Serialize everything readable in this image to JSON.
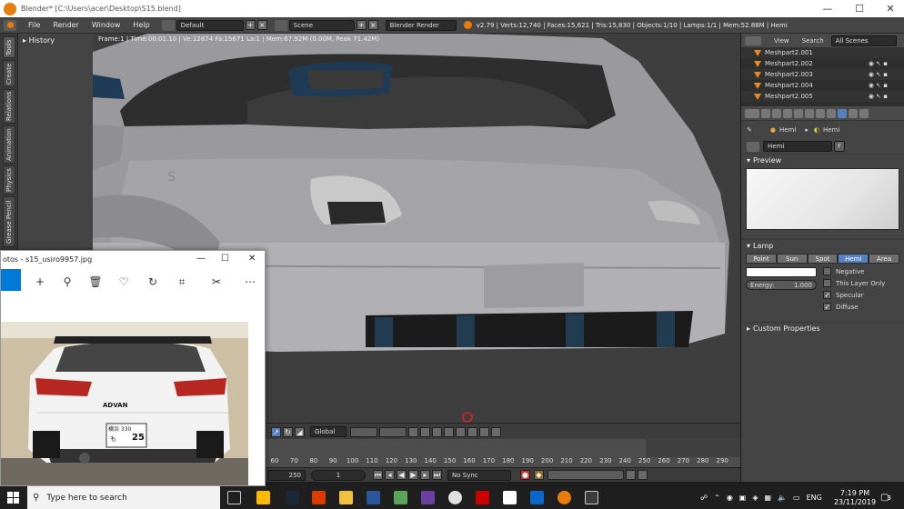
{
  "window": {
    "title": "Blender* [C:\\Users\\acer\\Desktop\\S15.blend]",
    "minimize": "—",
    "maximize": "☐",
    "close": "✕"
  },
  "menubar": {
    "items": [
      "File",
      "Render",
      "Window",
      "Help"
    ],
    "layout": "Default",
    "scene": "Scene",
    "engine": "Blender Render",
    "stats": "v2.79 | Verts:12,740 | Faces:15,621 | Tris:15,830 | Objects:1/10 | Lamps:1/1 | Mem:52.88M | Hemi"
  },
  "tooltabs": [
    "Tools",
    "Create",
    "Relations",
    "Animation",
    "Physics",
    "Grease Pencil"
  ],
  "history": {
    "label": "History"
  },
  "viewport": {
    "info": "Frame:1 | Time:00:01.10 | Ve:12874 Fa:15671 La:1 | Mem:67.92M (0.00M, Peak 71.42M)"
  },
  "outliner": {
    "view": "View",
    "search": "Search",
    "filter": "All Scenes",
    "items": [
      "Meshpart2.001",
      "Meshpart2.002",
      "Meshpart2.003",
      "Meshpart2.004",
      "Meshpart2.005"
    ]
  },
  "properties": {
    "breadcrumb_obj": "Hemi",
    "breadcrumb_data": "Hemi",
    "datablock": "Hemi",
    "datablock_user": "F",
    "preview_label": "Preview",
    "lamp_label": "Lamp",
    "lamp_types": [
      "Point",
      "Sun",
      "Spot",
      "Hemi",
      "Area"
    ],
    "lamp_active": "Hemi",
    "energy_label": "Energy:",
    "energy_value": "1.000",
    "options": [
      {
        "label": "Negative",
        "checked": false
      },
      {
        "label": "This Layer Only",
        "checked": false
      },
      {
        "label": "Specular",
        "checked": true
      },
      {
        "label": "Diffuse",
        "checked": true
      }
    ],
    "custom_props": "Custom Properties"
  },
  "timeline": {
    "orientation": "Global",
    "ticks": [
      "60",
      "70",
      "80",
      "90",
      "100",
      "110",
      "120",
      "130",
      "140",
      "150",
      "160",
      "170",
      "180",
      "190",
      "200",
      "210",
      "220",
      "230",
      "240",
      "250",
      "260",
      "270",
      "280",
      "290"
    ],
    "end_frame": "250",
    "current_frame": "1",
    "sync": "No Sync"
  },
  "photos": {
    "title": "otos - s15_usiro9957.jpg",
    "minimize": "—",
    "maximize": "☐",
    "close": "✕",
    "plate_top": "横浜 330",
    "plate_num": "25",
    "plate_prefix": "も",
    "brand": "ADVAN"
  },
  "taskbar": {
    "search_placeholder": "Type here to search",
    "lang": "ENG",
    "time": "7:19 PM",
    "date": "23/11/2019",
    "notifications": "3"
  }
}
